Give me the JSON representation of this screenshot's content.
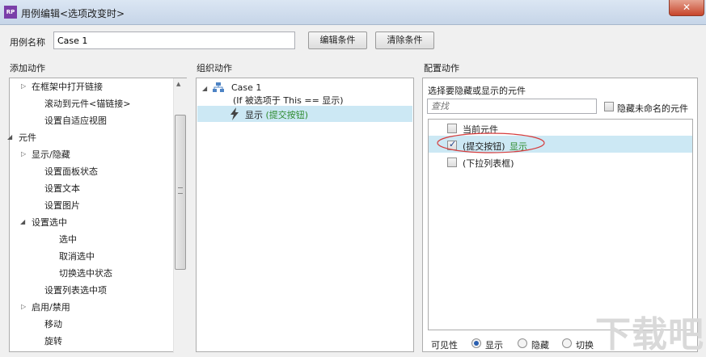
{
  "window": {
    "app_icon_text": "RP",
    "title": "用例编辑<选项改变时>",
    "close_label": "✕"
  },
  "case_name": {
    "label": "用例名称",
    "value": "Case 1"
  },
  "buttons": {
    "edit_condition": "编辑条件",
    "clear_condition": "清除条件"
  },
  "add_actions": {
    "header": "添加动作",
    "items": [
      {
        "label": "在框架中打开链接",
        "arrow": "▷"
      },
      {
        "label": "滚动到元件<锚链接>",
        "arrow": ""
      },
      {
        "label": "设置自适应视图",
        "arrow": ""
      },
      {
        "label": "元件",
        "arrow": "◢"
      },
      {
        "label": "显示/隐藏",
        "arrow": "▷"
      },
      {
        "label": "设置面板状态",
        "arrow": ""
      },
      {
        "label": "设置文本",
        "arrow": ""
      },
      {
        "label": "设置图片",
        "arrow": ""
      },
      {
        "label": "设置选中",
        "arrow": "◢"
      },
      {
        "label": "选中",
        "arrow": ""
      },
      {
        "label": "取消选中",
        "arrow": ""
      },
      {
        "label": "切换选中状态",
        "arrow": ""
      },
      {
        "label": "设置列表选中项",
        "arrow": ""
      },
      {
        "label": "启用/禁用",
        "arrow": "▷"
      },
      {
        "label": "移动",
        "arrow": ""
      },
      {
        "label": "旋转",
        "arrow": ""
      }
    ]
  },
  "organize_actions": {
    "header": "组织动作",
    "case_arrow": "◢",
    "case_label": "Case 1",
    "condition": "(If 被选项于 This == 显示)",
    "action_verb": "显示",
    "action_target": "(提交按钮)"
  },
  "configure_actions": {
    "header": "配置动作",
    "instruction": "选择要隐藏或显示的元件",
    "search_placeholder": "查找",
    "hide_unnamed_label": "隐藏未命名的元件",
    "widgets": [
      {
        "label": "当前元件",
        "checked": false,
        "status": ""
      },
      {
        "label": "(提交按钮)",
        "checked": true,
        "status": "显示"
      },
      {
        "label": "(下拉列表框)",
        "checked": false,
        "status": ""
      }
    ],
    "visibility_label": "可见性",
    "visibility_options": [
      "显示",
      "隐藏",
      "切换"
    ],
    "visibility_selected": "显示"
  },
  "watermark": "下载吧"
}
